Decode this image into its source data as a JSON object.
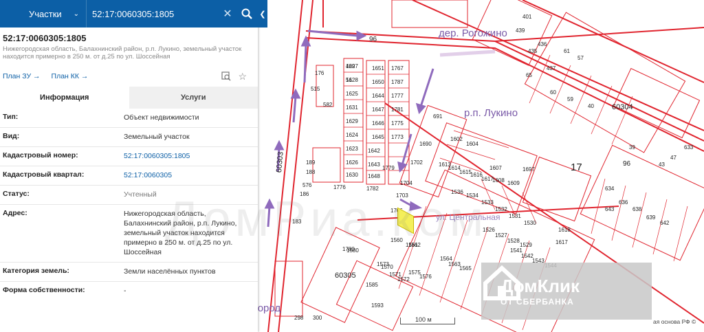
{
  "search": {
    "category": "Участки",
    "query": "52:17:0060305:1805",
    "clear_icon": "close-icon",
    "search_icon": "search-icon"
  },
  "panel": {
    "collapse_icon": "chevron-left-icon",
    "title": "52:17:0060305:1805",
    "address_short": "Нижегородская область, Балахнинский район, р.п. Лукино, земельный участок находится примерно в 250 м. от д.25 по ул. Шоссейная",
    "link_plan_zu": "План ЗУ →",
    "link_plan_kk": "План КК →",
    "tabs": [
      "Информация",
      "Услуги"
    ],
    "rows": [
      {
        "key": "Тип:",
        "value": "Объект недвижимости"
      },
      {
        "key": "Вид:",
        "value": "Земельный участок"
      },
      {
        "key": "Кадастровый номер:",
        "value": "52:17:0060305:1805"
      },
      {
        "key": "Кадастровый квартал:",
        "value": "52:17:0060305"
      },
      {
        "key": "Статус:",
        "value": "Учтенный"
      },
      {
        "key": "Адрес:",
        "value": "Нижегородская область, Балахнинский район, р.п. Лукино, земельный участок находится примерно в 250 м. от д.25 по ул. Шоссейная"
      },
      {
        "key": "Категория земель:",
        "value": "Земли населённых пунктов"
      },
      {
        "key": "Форма собственности:",
        "value": "-"
      }
    ]
  },
  "map": {
    "places": {
      "rogozhino": "дер. Рогожино",
      "lukino": "р.п. Лукино",
      "centralnaya": "ул. Центральная",
      "nizhny": "г. Нижний Новгород"
    },
    "block_labels": [
      "60304",
      "60305",
      "60303",
      "17",
      "96",
      "96"
    ],
    "parcels": [
      "1627",
      "1628",
      "1625",
      "1631",
      "1629",
      "1624",
      "1623",
      "1626",
      "1630",
      "1776",
      "1651",
      "1767",
      "1650",
      "1787",
      "1644",
      "1777",
      "1647",
      "1781",
      "1646",
      "1775",
      "1645",
      "1773",
      "1642",
      "1643",
      "1648",
      "1782",
      "1779",
      "1702",
      "1703",
      "1704",
      "1706",
      "1560",
      "1561",
      "1580",
      "1573",
      "1585",
      "1593",
      "691",
      "1690",
      "1602",
      "1604",
      "1613",
      "1614",
      "1615",
      "1616",
      "1617",
      "1607",
      "1608",
      "1609",
      "1697",
      "176",
      "515",
      "582",
      "189",
      "188",
      "576",
      "186",
      "183",
      "1780",
      "1570",
      "1571",
      "1572",
      "1575",
      "1576",
      "1562",
      "1564",
      "1563",
      "1565",
      "1618",
      "1617",
      "1530",
      "1531",
      "1532",
      "1533",
      "1534",
      "1536",
      "1526",
      "1527",
      "1528",
      "1529",
      "1541",
      "1542",
      "1543",
      "1544",
      "435",
      "436",
      "437",
      "61",
      "57",
      "65",
      "60",
      "59",
      "40",
      "43",
      "47",
      "39",
      "633",
      "634",
      "636",
      "638",
      "639",
      "642",
      "643",
      "300",
      "298",
      "401",
      "439",
      "429",
      "51"
    ],
    "scale_label": "100 м",
    "copyright": "ая основа РФ ©",
    "watermark": "ДомРиа.ком",
    "logo_title": "ДомКлик",
    "logo_subtitle": "ОТ СБЕРБАНКА"
  },
  "colors": {
    "accent": "#0c5fa6",
    "parcel": "#e0242e",
    "arrow": "#8f6bbd",
    "highlight": "#f4ef5a"
  }
}
